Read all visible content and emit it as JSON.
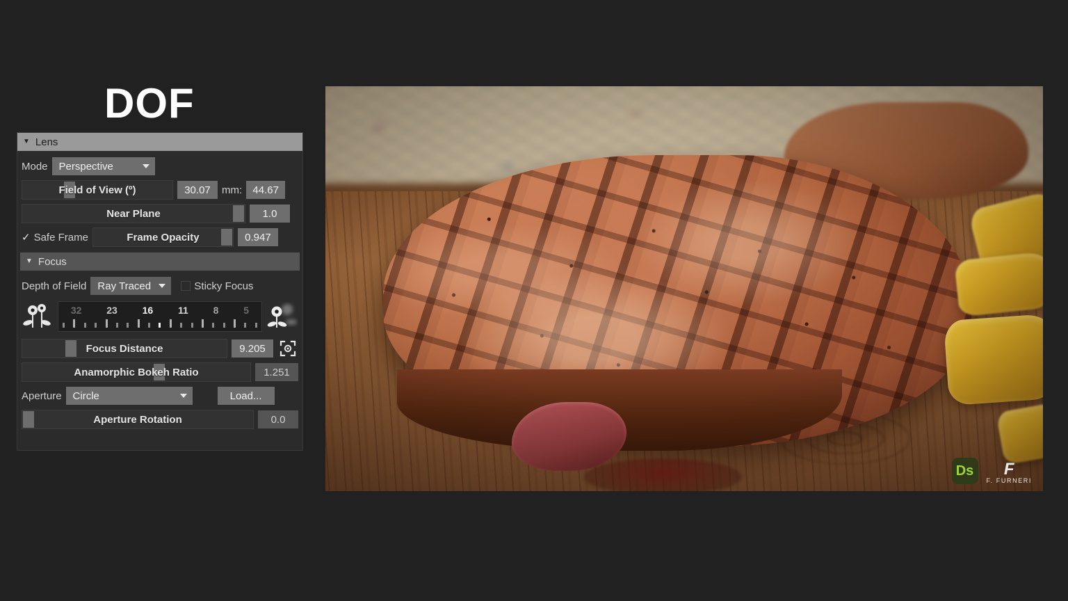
{
  "title": "DOF",
  "panel": {
    "lens_section": {
      "header": "Lens",
      "collapse_icon": "triangle-down-icon",
      "mode_label": "Mode",
      "mode_value": "Perspective",
      "fov_label": "Field of View (º)",
      "fov_value": "30.07",
      "mm_label": "mm:",
      "mm_value": "44.67",
      "near_plane_label": "Near Plane",
      "near_plane_value": "1.0",
      "safe_frame_label": "Safe Frame",
      "safe_frame_checked": "✓",
      "frame_opacity_label": "Frame Opacity",
      "frame_opacity_value": "0.947"
    },
    "focus_section": {
      "header": "Focus",
      "collapse_icon": "triangle-down-icon",
      "dof_label": "Depth of Field",
      "dof_value": "Ray Traced",
      "sticky_focus_label": "Sticky Focus",
      "fstop_scale": [
        "32",
        "23",
        "16",
        "11",
        "8",
        "5"
      ],
      "fstop_tick_count": 19,
      "flower_sharp_icon": "flower-sharp-icon",
      "flower_blurred_icon": "flower-blurred-icon",
      "focus_distance_label": "Focus Distance",
      "focus_distance_value": "9.205",
      "focus_picker_icon": "focus-target-icon",
      "bokeh_ratio_label": "Anamorphic Bokeh Ratio",
      "bokeh_ratio_value": "1.251",
      "aperture_label": "Aperture",
      "aperture_value": "Circle",
      "load_button": "Load...",
      "aperture_rotation_label": "Aperture Rotation",
      "aperture_rotation_value": "0.0"
    }
  },
  "render": {
    "subject": "grilled steak on wooden board with potato wedges",
    "watermark": {
      "app_badge": "Ds",
      "author_mark": "F",
      "author_name": "F. FURNERI"
    }
  },
  "colors": {
    "background": "#212121",
    "panel_bg": "#2b2b2b",
    "lens_header_bg": "#9a9a9a",
    "focus_header_bg": "#555555",
    "control_bg": "#6e6e6e",
    "track_bg": "#323232",
    "text": "#cfcfcf"
  }
}
